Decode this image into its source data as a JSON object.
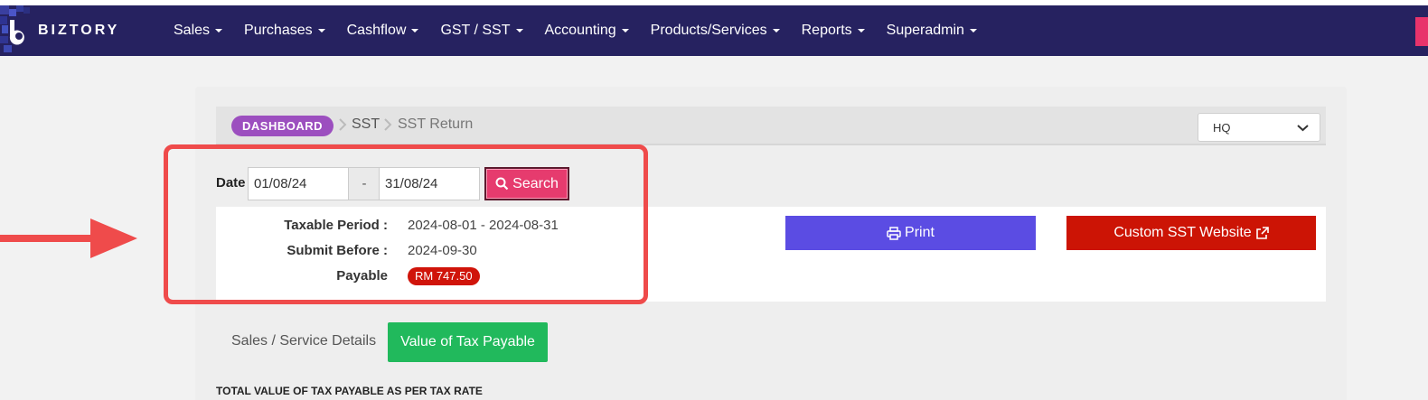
{
  "app": {
    "brand": "BIZTORY"
  },
  "nav": {
    "items": [
      {
        "label": "Sales"
      },
      {
        "label": "Purchases"
      },
      {
        "label": "Cashflow"
      },
      {
        "label": "GST / SST"
      },
      {
        "label": "Accounting"
      },
      {
        "label": "Products/Services"
      },
      {
        "label": "Reports"
      },
      {
        "label": "Superadmin"
      }
    ]
  },
  "breadcrumb": {
    "root": "DASHBOARD",
    "level1": "SST",
    "current": "SST Return"
  },
  "branch_select": {
    "value": "HQ"
  },
  "filter": {
    "date_label": "Date",
    "date_from": "01/08/24",
    "separator": "-",
    "date_to": "31/08/24",
    "search_label": "Search"
  },
  "summary": {
    "taxable_period_label": "Taxable Period :",
    "taxable_period_value": "2024-08-01 - 2024-08-31",
    "submit_before_label": "Submit Before :",
    "submit_before_value": "2024-09-30",
    "payable_label": "Payable",
    "payable_value": "RM 747.50"
  },
  "actions": {
    "print_label": "Print",
    "custom_sst_label": "Custom SST Website"
  },
  "tabs": {
    "sales_service_details": "Sales / Service Details",
    "value_of_tax_payable": "Value of Tax Payable"
  },
  "section": {
    "heading": "TOTAL VALUE OF TAX PAYABLE AS PER TAX RATE"
  },
  "colors": {
    "navbar": "#262260",
    "search": "#e63b6e",
    "print": "#5b4ce3",
    "custom_sst": "#cc1405",
    "active_tab": "#21b95c",
    "annotation": "#ef4b4b",
    "breadcrumb_pill": "#9c4fbf"
  },
  "icons": {
    "search": "search-icon",
    "print": "printer-icon",
    "external": "external-link-icon",
    "breadcrumb_sep": "chevron-right-icon",
    "select": "chevron-down-icon"
  }
}
